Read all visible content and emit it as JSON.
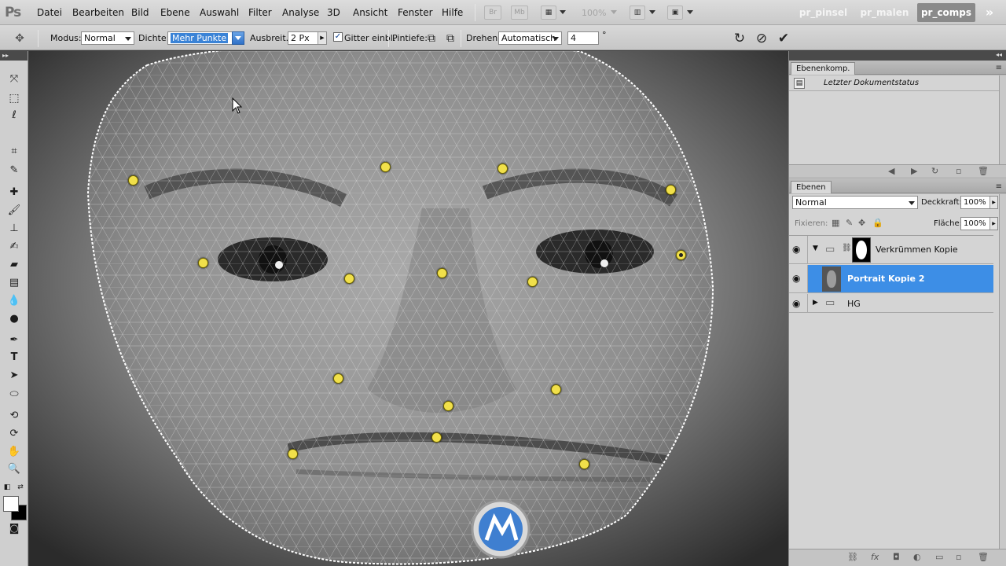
{
  "app": {
    "logo": "Ps"
  },
  "menu": [
    "Datei",
    "Bearbeiten",
    "Bild",
    "Ebene",
    "Auswahl",
    "Filter",
    "Analyse",
    "3D",
    "Ansicht",
    "Fenster",
    "Hilfe"
  ],
  "appbar": {
    "br": "Br",
    "mb": "Mb",
    "zoom": "100%"
  },
  "workspaces": [
    "pr_pinsel",
    "pr_malen",
    "pr_comps"
  ],
  "workspace_more": "»",
  "options": {
    "modus_label": "Modus:",
    "modus_value": "Normal",
    "dichte_label": "Dichte:",
    "dichte_value": "Mehr Punkte",
    "ausbreit_label": "Ausbreit.:",
    "ausbreit_value": "2 Px",
    "gitter_label": "Gitter einbl.",
    "pintiefe_label": "Pintiefe:",
    "drehen_label": "Drehen:",
    "drehen_value": "Automatisch",
    "angle_value": "4",
    "degree": "°"
  },
  "panels": {
    "comps": {
      "title": "Ebenenkomp.",
      "last_state": "Letzter Dokumentstatus"
    },
    "layers": {
      "title": "Ebenen",
      "blend_mode": "Normal",
      "opacity_label": "Deckkraft:",
      "opacity_value": "100%",
      "lock_label": "Fixieren:",
      "fill_label": "Fläche:",
      "fill_value": "100%",
      "items": [
        {
          "name": "Verkrümmen Kopie",
          "selected": false
        },
        {
          "name": "Portrait Kopie 2",
          "selected": true
        },
        {
          "name": "HG",
          "selected": false
        }
      ]
    }
  },
  "colors": {
    "pin": "#f1e04a",
    "selected_layer": "#3d8ee6",
    "ws_active": "#8a8a8a"
  }
}
